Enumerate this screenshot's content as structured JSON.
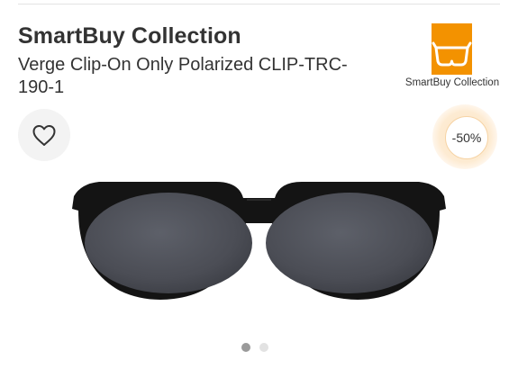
{
  "product": {
    "brand": "SmartBuy Collection",
    "title": "Verge Clip-On Only Polarized CLIP-TRC-190-1"
  },
  "logo": {
    "text": "SmartBuy Collection",
    "color": "#f39200"
  },
  "favorite": {
    "icon": "heart-outline-icon"
  },
  "discount": {
    "label": "-50%"
  },
  "gallery": {
    "slide_count": 2,
    "active_index": 0
  },
  "colors": {
    "text": "#333333",
    "accent": "#f39200",
    "dot_active": "#9a9a9a",
    "dot_inactive": "#e2e2e2"
  }
}
